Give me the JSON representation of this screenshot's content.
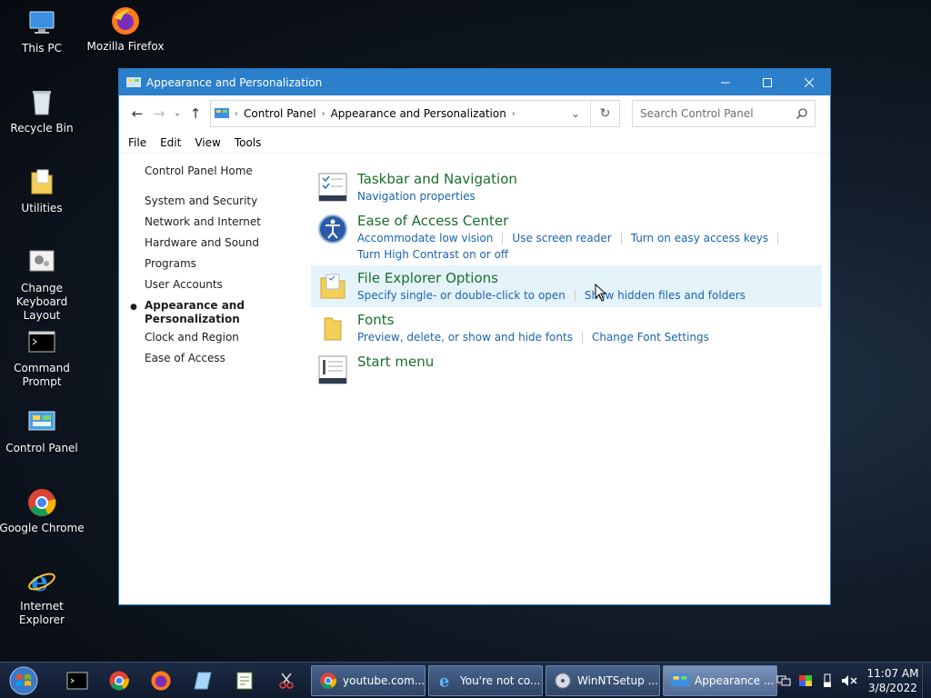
{
  "desktop": {
    "icons": [
      {
        "label": "This PC"
      },
      {
        "label": "Mozilla Firefox"
      },
      {
        "label": "Recycle Bin"
      },
      {
        "label": "Utilities"
      },
      {
        "label": "Change Keyboard Layout"
      },
      {
        "label": "Command Prompt"
      },
      {
        "label": "Control Panel"
      },
      {
        "label": "Google Chrome"
      },
      {
        "label": "Internet Explorer"
      }
    ]
  },
  "window": {
    "title": "Appearance and Personalization",
    "address": {
      "crumbs": [
        "Control Panel",
        "Appearance and Personalization"
      ]
    },
    "search_placeholder": "Search Control Panel",
    "menu": [
      "File",
      "Edit",
      "View",
      "Tools"
    ],
    "leftnav": {
      "home": "Control Panel Home",
      "items": [
        "System and Security",
        "Network and Internet",
        "Hardware and Sound",
        "Programs",
        "User Accounts"
      ],
      "active": "Appearance and Personalization",
      "items_after": [
        "Clock and Region",
        "Ease of Access"
      ]
    },
    "categories": [
      {
        "heading": "Taskbar and Navigation",
        "links": [
          "Navigation properties"
        ]
      },
      {
        "heading": "Ease of Access Center",
        "links": [
          "Accommodate low vision",
          "Use screen reader",
          "Turn on easy access keys"
        ],
        "links2": [
          "Turn High Contrast on or off"
        ]
      },
      {
        "heading": "File Explorer Options",
        "links": [
          "Specify single- or double-click to open",
          "Show hidden files and folders"
        ]
      },
      {
        "heading": "Fonts",
        "links": [
          "Preview, delete, or show and hide fonts",
          "Change Font Settings"
        ]
      },
      {
        "heading": "Start menu",
        "links": []
      }
    ]
  },
  "taskbar": {
    "tasks": [
      {
        "label": "youtube.com..."
      },
      {
        "label": "You're not co..."
      },
      {
        "label": "WinNTSetup ..."
      },
      {
        "label": "Appearance ..."
      }
    ],
    "clock": {
      "time": "11:07 AM",
      "date": "3/8/2022"
    }
  },
  "colors": {
    "titlebar": "#2b7fcb",
    "category_heading": "#1a6e2b",
    "link": "#1a64b0",
    "hover_row": "#e5f3fb"
  }
}
